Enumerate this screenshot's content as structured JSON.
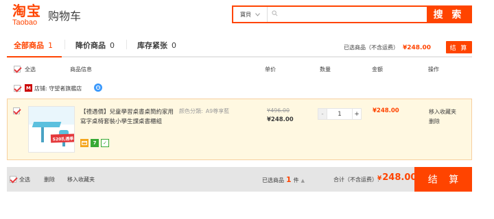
{
  "header": {
    "logo_cn": "淘宝",
    "logo_en": "Taobao",
    "page_title": "购物车"
  },
  "search": {
    "type_label": "寶貝",
    "type_chevron": "chevron-down-icon",
    "placeholder": "",
    "value": "",
    "button_label": "搜 索"
  },
  "tabs": [
    {
      "label": "全部商品",
      "count": "1",
      "active": true
    },
    {
      "label": "降价商品",
      "count": "0",
      "active": false
    },
    {
      "label": "库存紧张",
      "count": "0",
      "active": false
    }
  ],
  "summary_top": {
    "label": "已选商品（不含运费）",
    "amount": "¥248.00",
    "settle_label": "结 算"
  },
  "columns": {
    "select_all": "全选",
    "info": "商品信息",
    "unit_price": "单价",
    "quantity": "数量",
    "amount": "金额",
    "actions": "操作"
  },
  "shop": {
    "logo_text": "M",
    "label": "店铺:",
    "name": "守望者旗艦店",
    "ww_icon": "aliwangwang-icon"
  },
  "item": {
    "title": "【禮遇價】兒童學習桌書桌簡約家用寫字桌椅套裝小學生課桌書櫃組",
    "thumb_badge": "S20扎透季",
    "sku_label": "颜色分類:",
    "sku_value": "A9尊享藍",
    "price_old": "¥496.00",
    "price_now": "¥248.00",
    "quantity": "1",
    "minus": "-",
    "plus": "+",
    "sum": "¥248.00",
    "op_fav": "移入收藏夹",
    "op_del": "删除",
    "services": [
      "credit-card-icon",
      "7",
      "✓"
    ]
  },
  "bottom": {
    "select_all": "全选",
    "delete": "删除",
    "move_fav": "移入收藏夹",
    "selected_label": "已选商品",
    "selected_count": "1",
    "selected_unit": "件",
    "total_label": "合计（不含运费）:",
    "total_yen": "¥",
    "total_amount": "248.00",
    "settle_label": "结 算"
  },
  "colors": {
    "accent": "#ff4400",
    "item_bg": "#fff8e1",
    "bar_bg": "#e5e5e5"
  }
}
